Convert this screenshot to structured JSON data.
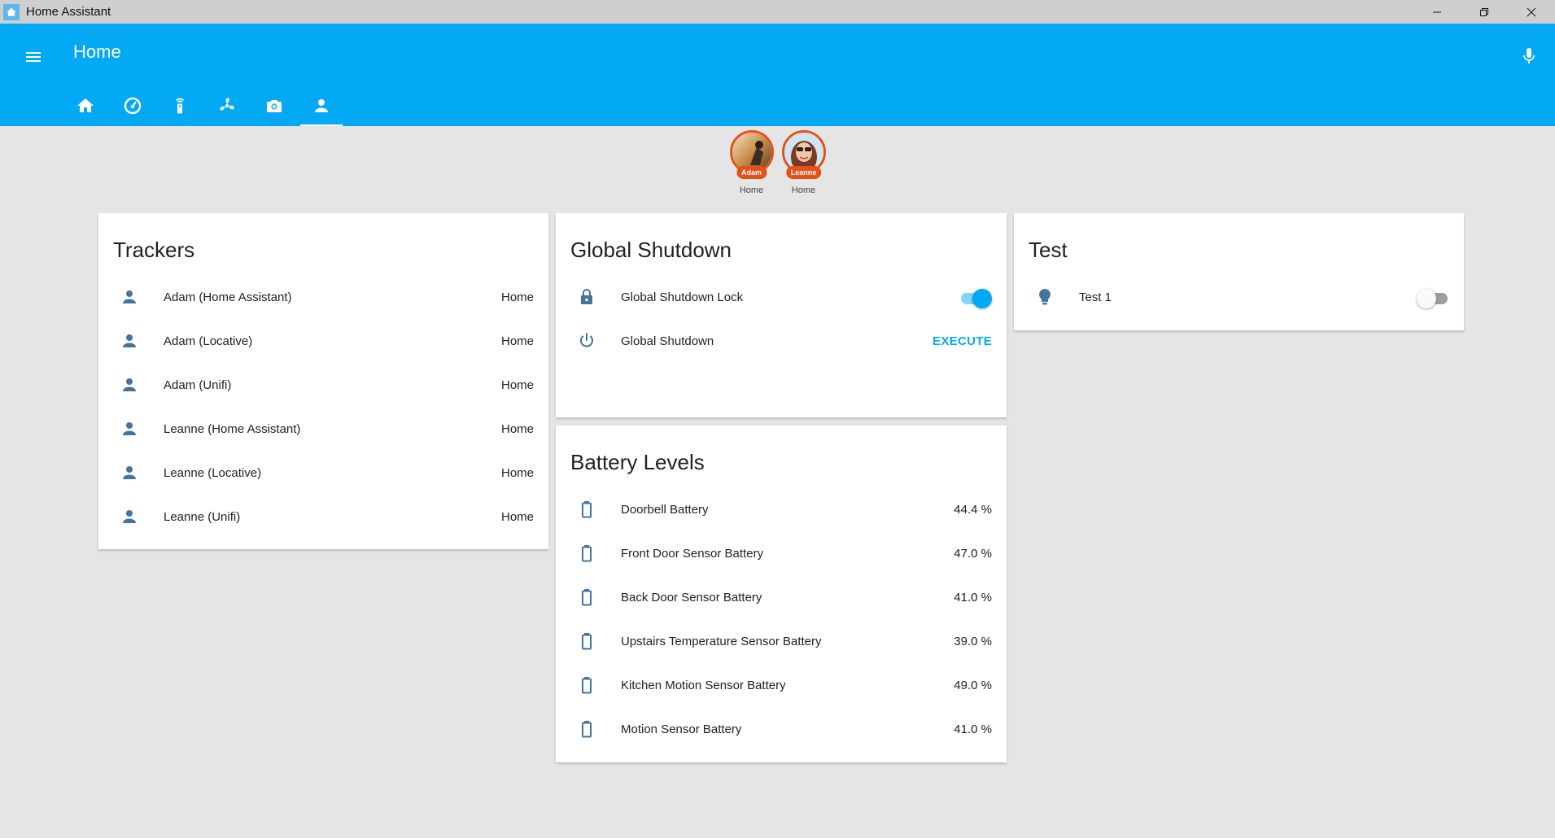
{
  "window": {
    "title": "Home Assistant"
  },
  "header": {
    "title": "Home"
  },
  "tabs": [
    {
      "name": "home",
      "icon": "home-icon"
    },
    {
      "name": "speedometer",
      "icon": "speedometer-icon"
    },
    {
      "name": "remote",
      "icon": "remote-icon"
    },
    {
      "name": "fan",
      "icon": "fan-icon"
    },
    {
      "name": "camera",
      "icon": "camera-icon"
    },
    {
      "name": "people",
      "icon": "account-icon",
      "active": true
    }
  ],
  "badges": [
    {
      "tag": "Adam",
      "state": "Home"
    },
    {
      "tag": "Leanne",
      "state": "Home"
    }
  ],
  "trackers": {
    "title": "Trackers",
    "items": [
      {
        "label": "Adam (Home Assistant)",
        "state": "Home"
      },
      {
        "label": "Adam (Locative)",
        "state": "Home"
      },
      {
        "label": "Adam (Unifi)",
        "state": "Home"
      },
      {
        "label": "Leanne (Home Assistant)",
        "state": "Home"
      },
      {
        "label": "Leanne (Locative)",
        "state": "Home"
      },
      {
        "label": "Leanne (Unifi)",
        "state": "Home"
      }
    ]
  },
  "shutdown": {
    "title": "Global Shutdown",
    "lock_label": "Global Shutdown Lock",
    "lock_on": true,
    "script_label": "Global Shutdown",
    "execute_label": "EXECUTE"
  },
  "test": {
    "title": "Test",
    "item_label": "Test 1",
    "item_on": false
  },
  "battery": {
    "title": "Battery Levels",
    "items": [
      {
        "label": "Doorbell Battery",
        "value": "44.4 %"
      },
      {
        "label": "Front Door Sensor Battery",
        "value": "47.0 %"
      },
      {
        "label": "Back Door Sensor Battery",
        "value": "41.0 %"
      },
      {
        "label": "Upstairs Temperature Sensor Battery",
        "value": "39.0 %"
      },
      {
        "label": "Kitchen Motion Sensor Battery",
        "value": "49.0 %"
      },
      {
        "label": "Motion Sensor Battery",
        "value": "41.0 %"
      }
    ]
  },
  "colors": {
    "primary": "#03a9f4",
    "icon": "#44739e",
    "badge": "#e4511b"
  }
}
